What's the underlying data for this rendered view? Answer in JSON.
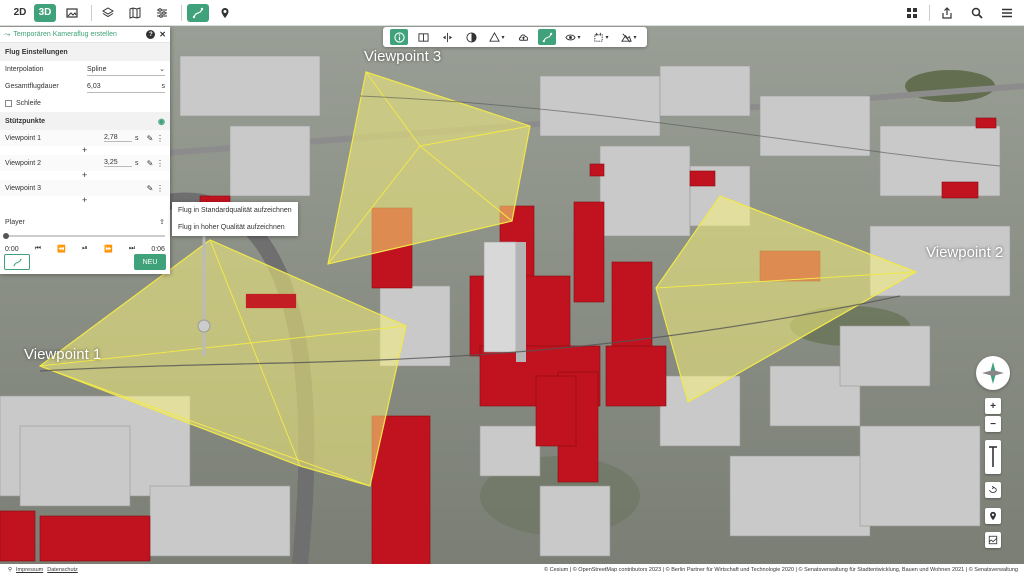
{
  "topbar": {
    "btn_2d": "2D",
    "btn_3d": "3D",
    "icons_left": [
      "image-icon",
      "layers-icon",
      "map-fold-icon",
      "sliders-icon",
      "flight-path-icon",
      "user-marker-icon"
    ],
    "icons_right": [
      "grid-icon",
      "share-icon",
      "search-icon",
      "menu-icon"
    ]
  },
  "panel": {
    "title": "Temporären Kameraflug erstellen",
    "help": "?",
    "close": "✕",
    "section_settings": "Flug Einstellungen",
    "interpolation_label": "Interpolation",
    "interpolation_value": "Spline",
    "duration_label": "Gesamtflugdauer",
    "duration_value": "6,03",
    "duration_unit": "s",
    "loop_label": "Schleife",
    "section_points": "Stützpunkte",
    "viewpoints": [
      {
        "name": "Viewpoint 1",
        "duration": "2,78",
        "unit": "s"
      },
      {
        "name": "Viewpoint 2",
        "duration": "3,25",
        "unit": "s"
      },
      {
        "name": "Viewpoint 3",
        "duration": "",
        "unit": ""
      }
    ],
    "player_label": "Player",
    "time_start": "0:00",
    "time_end": "0:06",
    "new_button": "NEU"
  },
  "popup": {
    "item_standard": "Flug in Standardqualität aufzeichnen",
    "item_high": "Flug in hoher Qualität aufzeichnen"
  },
  "map": {
    "labels": [
      "Viewpoint 1",
      "Viewpoint 2",
      "Viewpoint 3"
    ]
  },
  "nav": {
    "zoom_in": "+",
    "zoom_out": "−"
  },
  "footer": {
    "impressum": "Impressum",
    "datenschutz": "Datenschutz",
    "attribution": "© Cesium | © OpenStreetMap contributors 2023 | © Berlin Partner für Wirtschaft und Technologie 2020 | © Senatsverwaltung für Stadtentwicklung, Bauen und Wohnen 2021 | © Senatsverwaltung"
  },
  "colors": {
    "accent": "#3fa27a",
    "highlight_building": "#c0121f",
    "viewpoint_fill": "#f4ee7a"
  }
}
